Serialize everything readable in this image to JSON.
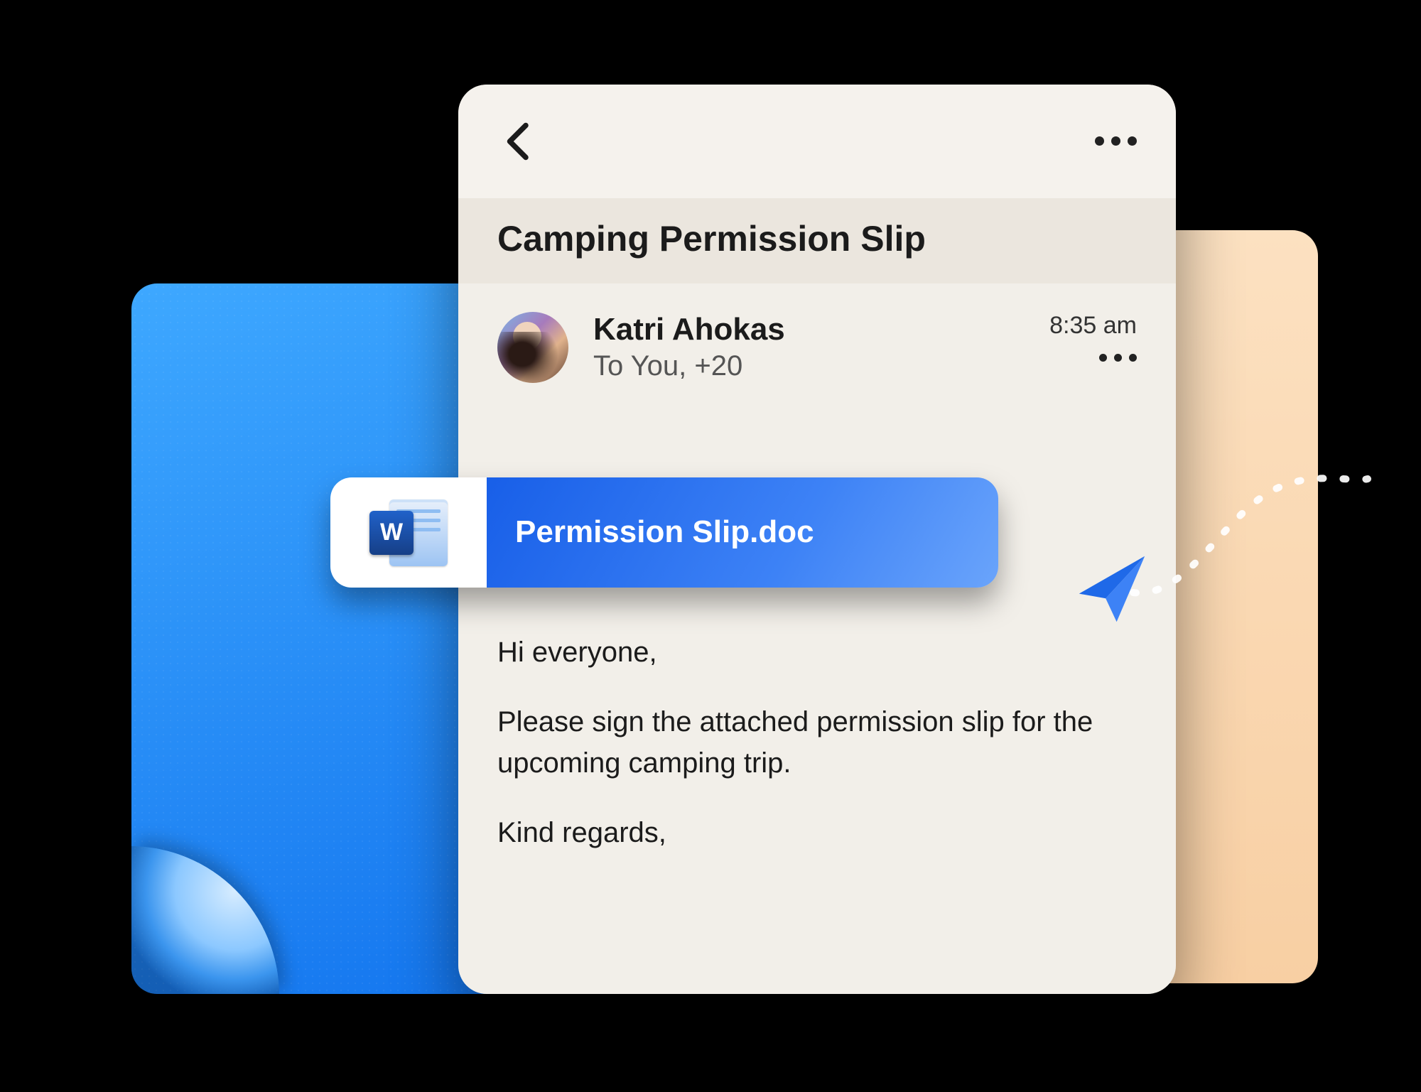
{
  "email": {
    "subject": "Camping Permission Slip",
    "sender": "Katri Ahokas",
    "recipients_line": "To You, +20",
    "timestamp": "8:35 am",
    "body": {
      "greeting": "Hi everyone,",
      "paragraph1": "Please sign the attached permission slip for the upcoming camping trip.",
      "signoff": "Kind regards,"
    }
  },
  "attachment": {
    "filename": "Permission Slip.doc",
    "icon_letter": "W"
  },
  "colors": {
    "brand_blue": "#185fe8",
    "accent_orange": "#f8cfa3"
  }
}
